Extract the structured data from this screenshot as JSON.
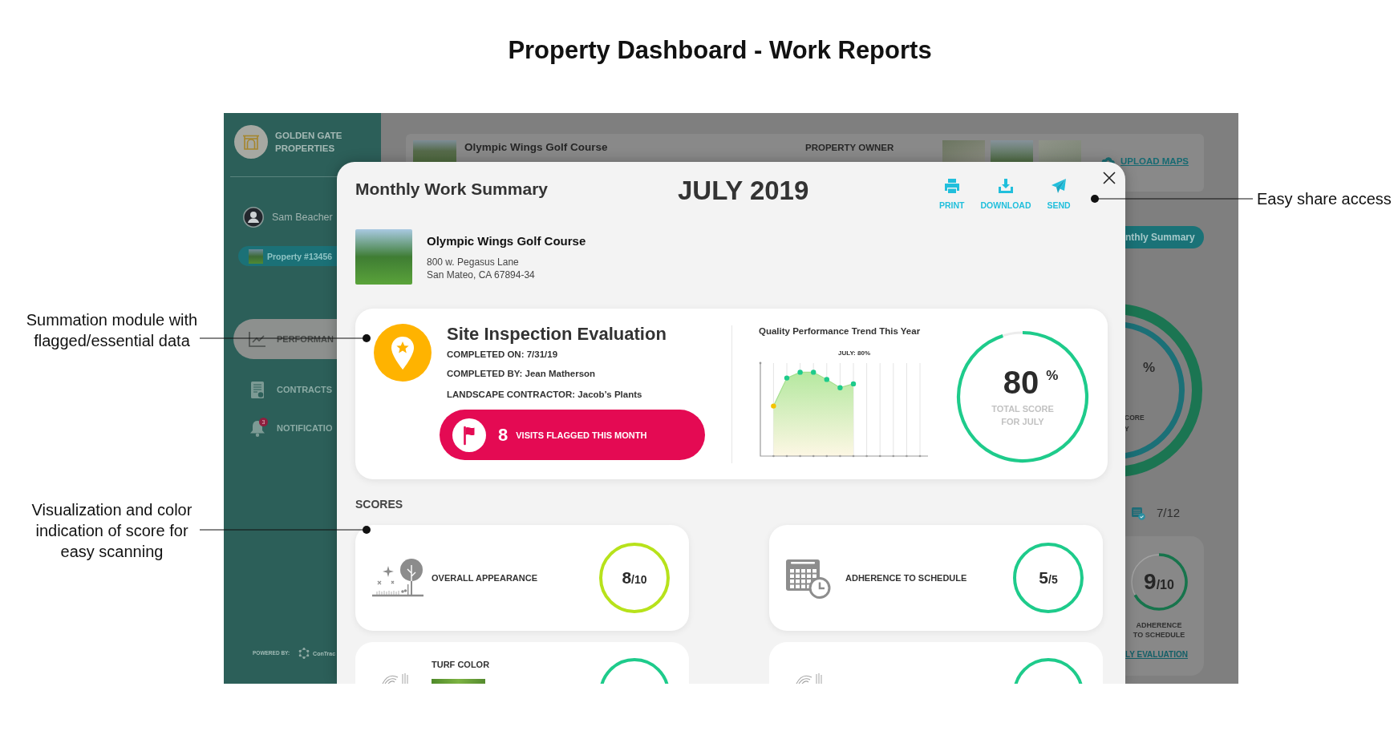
{
  "title": "Property Dashboard - Work Reports",
  "annotations": {
    "left": [
      "Summation module with flagged/essential data",
      "Visualization and color indication of score for easy scanning"
    ],
    "right": [
      "Easy share access"
    ]
  },
  "sidebar": {
    "brand": "GOLDEN GATE PROPERTIES",
    "user": "Sam Beacher",
    "property": "Property #13456",
    "nav": [
      {
        "label": "PERFORMAN",
        "selected": true
      },
      {
        "label": "CONTRACTS",
        "selected": false
      },
      {
        "label": "NOTIFICATIO",
        "selected": false,
        "badge": "3"
      }
    ],
    "powered_by": {
      "label": "POWERED BY:",
      "name": "ConTrac"
    }
  },
  "dashboard": {
    "property_name": "Olympic Wings Golf Course",
    "owner_label": "PROPERTY OWNER",
    "upload_link": "UPLOAD MAPS",
    "summary_button": "nthly Summary",
    "score_ring": {
      "unit": "%",
      "fragments": [
        "CORE",
        "Y"
      ]
    },
    "progress": "7/12",
    "score_card": {
      "score": "9",
      "total": "/10",
      "level": 0.67,
      "label": "ADHERENCE TO SCHEDULE",
      "link": "LY EVALUATION"
    }
  },
  "modal": {
    "title": "Monthly Work Summary",
    "period": "JULY 2019",
    "actions": [
      "PRINT",
      "DOWNLOAD",
      "SEND"
    ],
    "property": {
      "name": "Olympic Wings Golf Course",
      "address": [
        "800 w. Pegasus Lane",
        "San Mateo, CA 67894-34"
      ]
    },
    "inspection": {
      "title": "Site Inspection Evaluation",
      "details": [
        "COMPLETED ON: 7/31/19",
        "COMPLETED BY: Jean Matherson",
        "LANDSCAPE CONTRACTOR: Jacob’s Plants"
      ],
      "flagged_count": "8",
      "flagged_label": "VISITS FLAGGED THIS MONTH",
      "trend_title": "Quality Performance Trend This Year",
      "trend_marker": "JULY: 80%",
      "total": {
        "value": "80",
        "unit": "%",
        "label": "TOTAL SCORE FOR JULY",
        "level": 0.95
      }
    },
    "scores": {
      "title": "SCORES",
      "items": [
        {
          "kind": "full",
          "label": "OVERALL APPEARANCE",
          "score": "8",
          "total": "/10",
          "color": "#b7e21b"
        },
        {
          "kind": "full",
          "label": "ADHERENCE TO SCHEDULE",
          "score": "5",
          "total": "/5",
          "color": "#1ecb8b"
        },
        {
          "kind": "clipped",
          "label": "TURF COLOR",
          "photo": true,
          "color": "#1ecb8b"
        },
        {
          "kind": "clipped",
          "photo": false,
          "color": "#1ecb8b"
        }
      ]
    }
  }
}
